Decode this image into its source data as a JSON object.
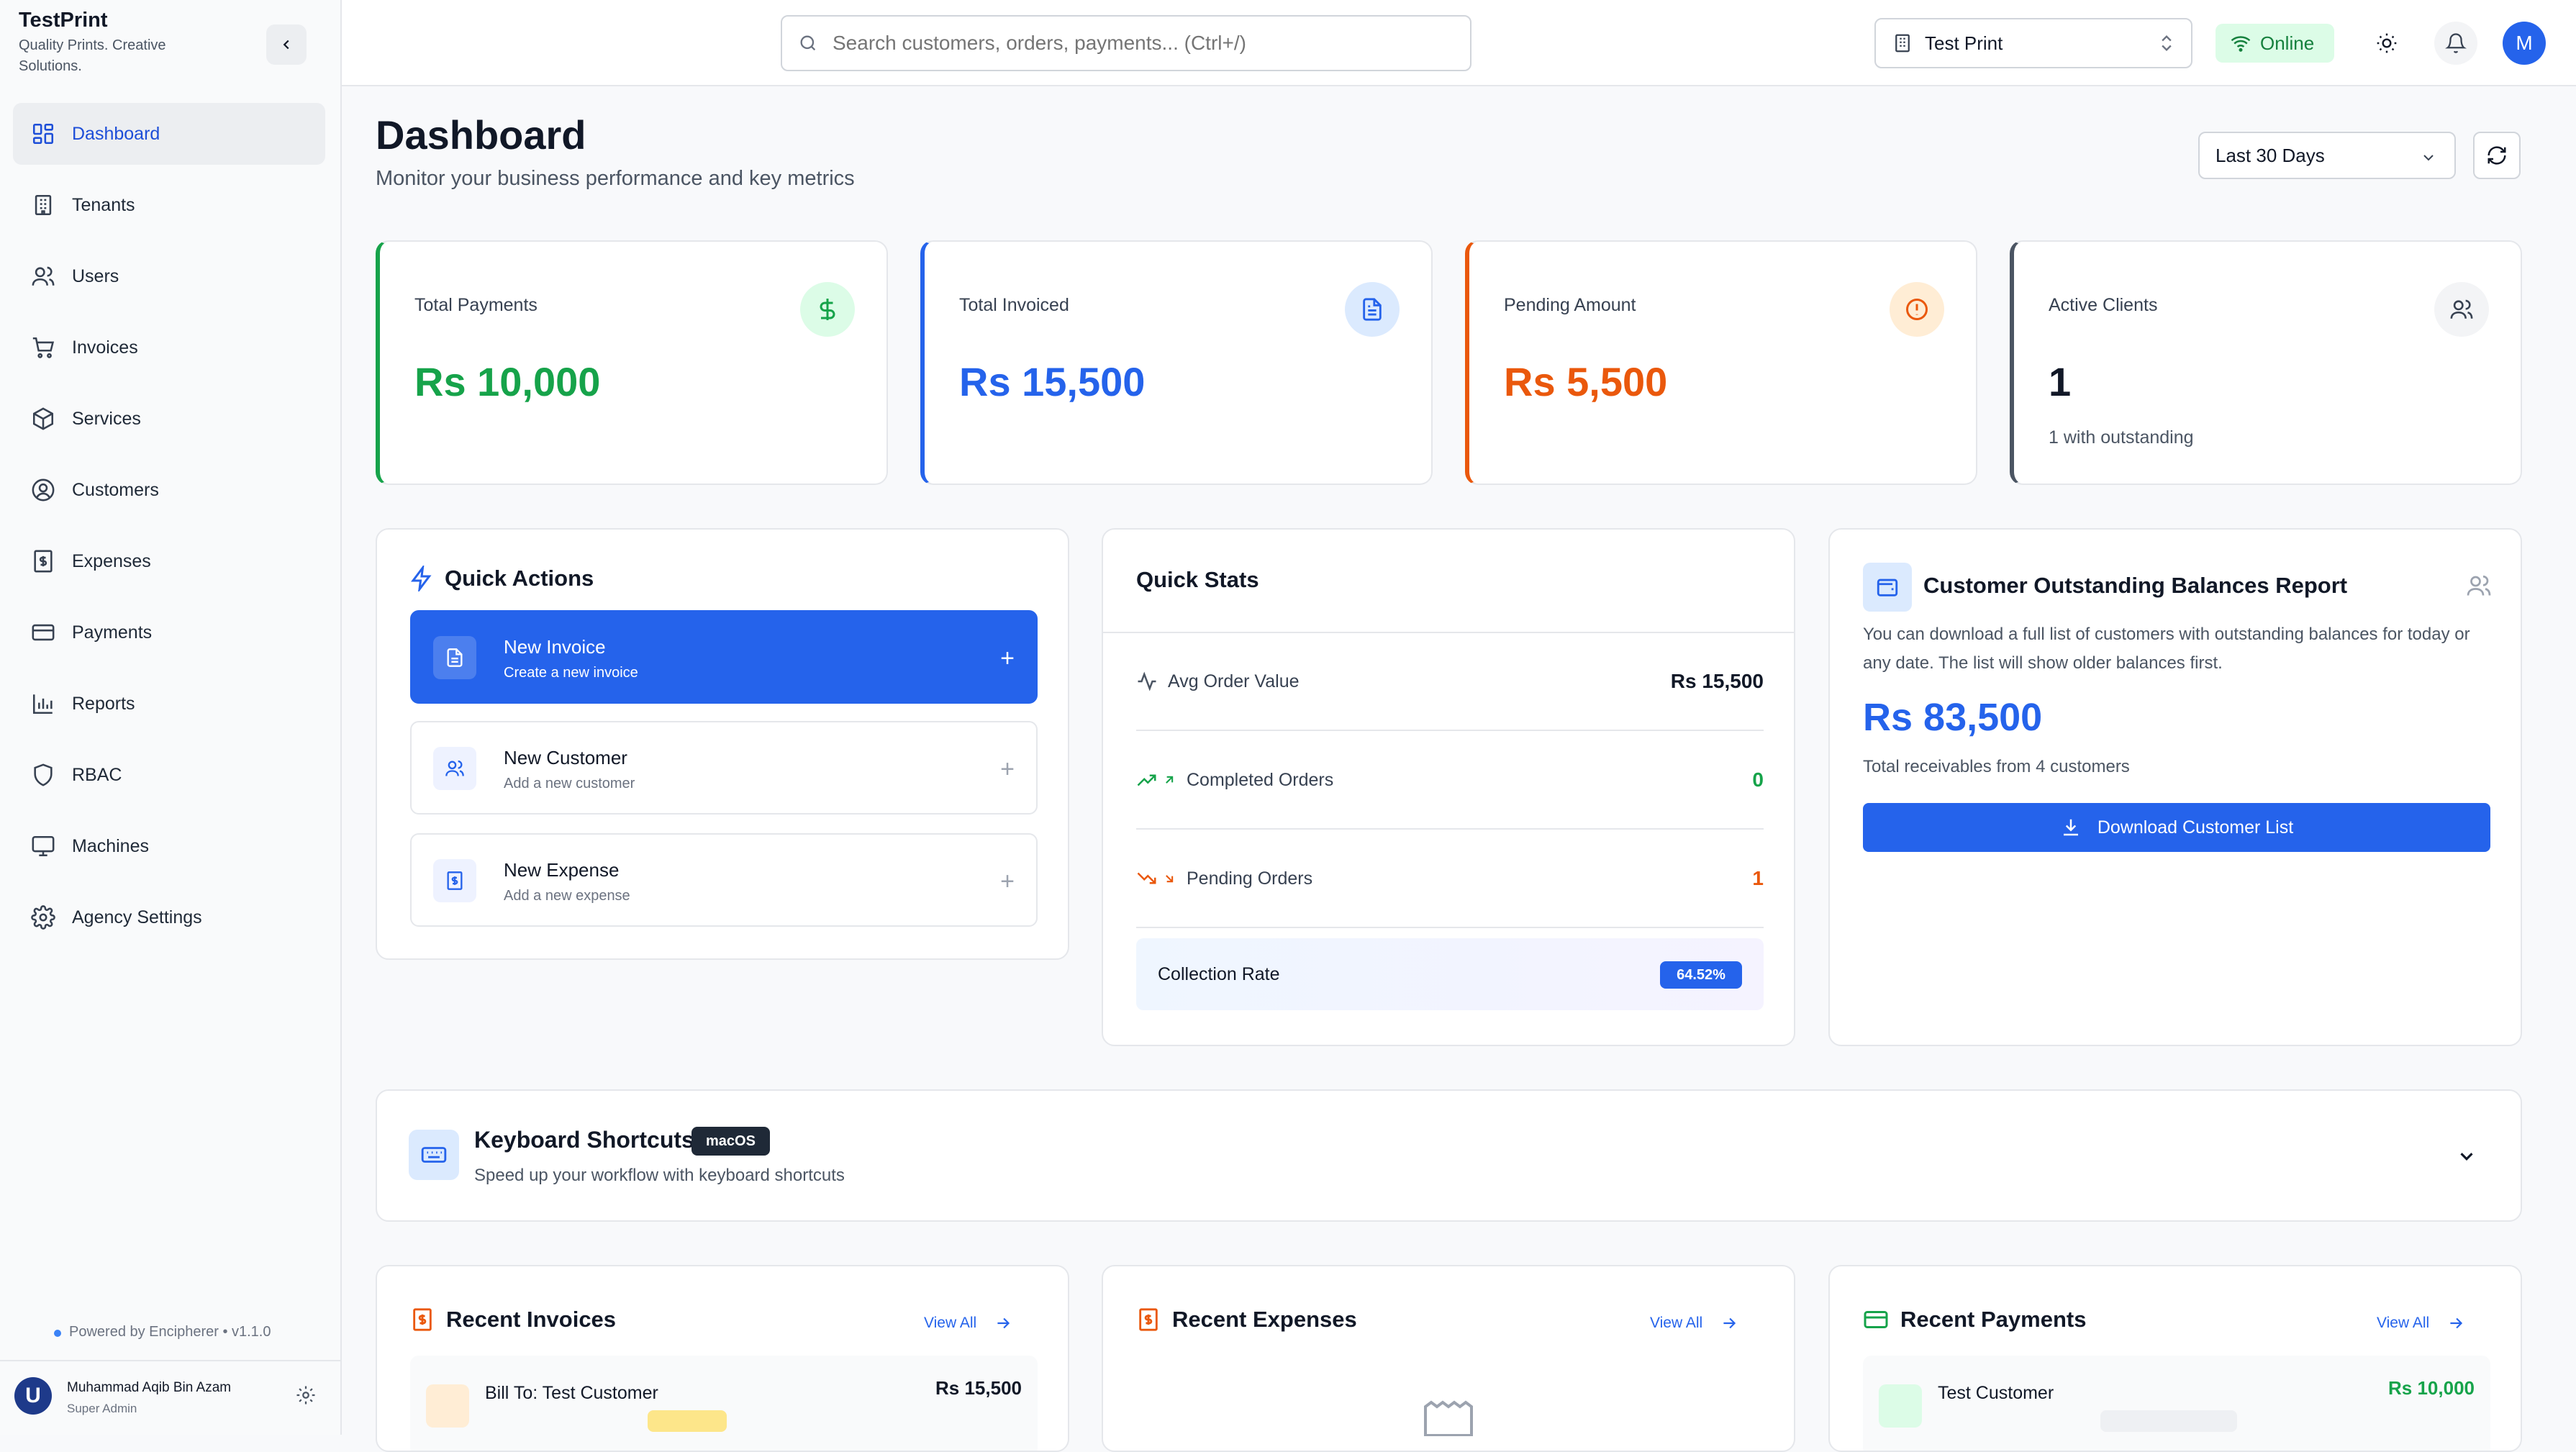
{
  "brand": {
    "name": "TestPrint",
    "tagline": "Quality Prints. Creative Solutions."
  },
  "sidebar": {
    "items": [
      {
        "label": "Dashboard",
        "icon": "dashboard-icon",
        "active": true
      },
      {
        "label": "Tenants",
        "icon": "building-icon"
      },
      {
        "label": "Users",
        "icon": "users-icon"
      },
      {
        "label": "Invoices",
        "icon": "cart-icon"
      },
      {
        "label": "Services",
        "icon": "box-icon"
      },
      {
        "label": "Customers",
        "icon": "user-circle-icon"
      },
      {
        "label": "Expenses",
        "icon": "receipt-icon"
      },
      {
        "label": "Payments",
        "icon": "credit-card-icon"
      },
      {
        "label": "Reports",
        "icon": "bar-chart-icon"
      },
      {
        "label": "RBAC",
        "icon": "shield-icon"
      },
      {
        "label": "Machines",
        "icon": "monitor-icon"
      },
      {
        "label": "Agency Settings",
        "icon": "gear-icon"
      }
    ],
    "powered_by": "Powered by Encipherer • v1.1.0",
    "user": {
      "initial": "U",
      "name": "Muhammad Aqib Bin Azam",
      "role": "Super Admin"
    }
  },
  "topbar": {
    "search_placeholder": "Search customers, orders, payments... (Ctrl+/)",
    "tenant": "Test Print",
    "status": "Online",
    "avatar_initial": "M"
  },
  "page": {
    "title": "Dashboard",
    "subtitle": "Monitor your business performance and key metrics",
    "date_range": "Last 30 Days"
  },
  "stats": [
    {
      "label": "Total Payments",
      "value": "Rs 10,000",
      "sub": "",
      "color": "#16a34a",
      "icon": "dollar-icon"
    },
    {
      "label": "Total Invoiced",
      "value": "Rs 15,500",
      "sub": "",
      "color": "#2563eb",
      "icon": "document-icon"
    },
    {
      "label": "Pending Amount",
      "value": "Rs 5,500",
      "sub": "",
      "color": "#ea580c",
      "icon": "alert-circle-icon"
    },
    {
      "label": "Active Clients",
      "value": "1",
      "sub": "1 with outstanding",
      "color": "#111827",
      "icon": "users-icon"
    }
  ],
  "quick_actions": {
    "title": "Quick Actions",
    "items": [
      {
        "title": "New Invoice",
        "sub": "Create a new invoice"
      },
      {
        "title": "New Customer",
        "sub": "Add a new customer"
      },
      {
        "title": "New Expense",
        "sub": "Add a new expense"
      }
    ]
  },
  "quick_stats": {
    "title": "Quick Stats",
    "rows": [
      {
        "label": "Avg Order Value",
        "value": "Rs 15,500"
      },
      {
        "label": "Completed Orders",
        "value": "0"
      },
      {
        "label": "Pending Orders",
        "value": "1"
      }
    ],
    "collection_label": "Collection Rate",
    "collection_rate": "64.52%"
  },
  "outstanding": {
    "title": "Customer Outstanding Balances Report",
    "description": "You can download a full list of customers with outstanding balances for today or any date. The list will show older balances first.",
    "amount": "Rs 83,500",
    "note": "Total receivables from 4 customers",
    "button": "Download Customer List"
  },
  "shortcuts": {
    "title": "Keyboard Shortcuts",
    "badge": "macOS",
    "subtitle": "Speed up your workflow with keyboard shortcuts"
  },
  "recent": {
    "invoices": {
      "title": "Recent Invoices",
      "view_all": "View All",
      "row_name": "Bill To: Test Customer",
      "row_amount": "Rs 15,500"
    },
    "expenses": {
      "title": "Recent Expenses",
      "view_all": "View All"
    },
    "payments": {
      "title": "Recent Payments",
      "view_all": "View All",
      "row_name": "Test Customer",
      "row_amount": "Rs 10,000"
    }
  }
}
